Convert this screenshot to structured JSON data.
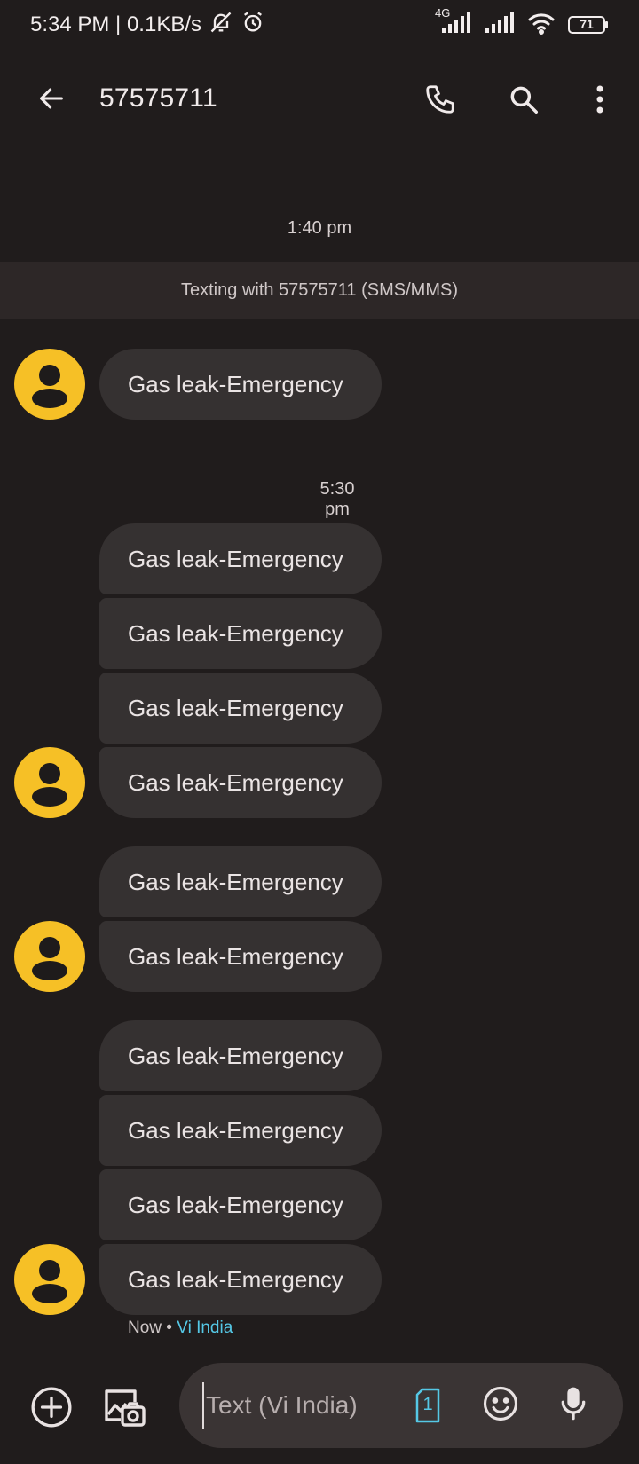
{
  "status_bar": {
    "time_speed": "5:34 PM | 0.1KB/s",
    "network_label": "4G",
    "battery_level": "71",
    "icons": [
      "bell-off-icon",
      "alarm-icon",
      "signal-icon",
      "signal-icon",
      "wifi-icon",
      "battery-icon"
    ]
  },
  "app_bar": {
    "title": "57575711",
    "icons": [
      "back-arrow-icon",
      "phone-icon",
      "search-icon",
      "more-vert-icon"
    ]
  },
  "conversation": {
    "timestamp_1": "1:40 pm",
    "banner": "Texting with 57575711 (SMS/MMS)",
    "timestamp_2": "5:30 pm",
    "messages": [
      "Gas leak-Emergency",
      "Gas leak-Emergency",
      "Gas leak-Emergency",
      "Gas leak-Emergency",
      "Gas leak-Emergency",
      "Gas leak-Emergency",
      "Gas leak-Emergency",
      "Gas leak-Emergency",
      "Gas leak-Emergency",
      "Gas leak-Emergency",
      "Gas leak-Emergency"
    ],
    "meta_time": "Now",
    "meta_sep": " • ",
    "meta_carrier": "Vi India"
  },
  "compose": {
    "placeholder": "Text (Vi India)",
    "sim_number": "1",
    "icons": [
      "add-circle-icon",
      "gallery-camera-icon",
      "sim-icon",
      "emoji-icon",
      "mic-icon"
    ]
  },
  "colors": {
    "background": "#201c1c",
    "bubble": "#353131",
    "avatar": "#f6c026",
    "accent": "#55c8e6"
  }
}
